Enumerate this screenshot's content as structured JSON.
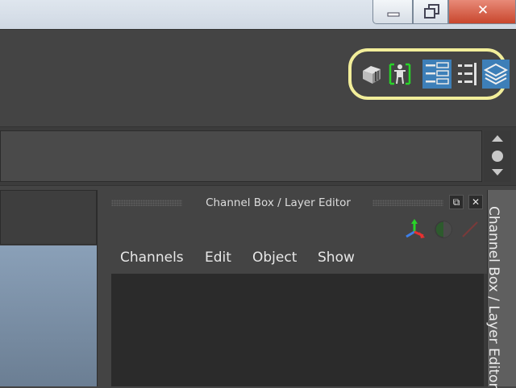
{
  "window": {
    "minimize_icon": "minimize-icon",
    "maximize_icon": "restore-icon",
    "close_icon": "close-icon",
    "close_glyph": "✕"
  },
  "toolbar": {
    "icons": [
      "modeling-toolkit-icon",
      "attribute-editor-icon",
      "tool-settings-icon",
      "channel-box-toggle-icon",
      "layer-editor-icon"
    ],
    "highlight_color": "#f2ee9a"
  },
  "channel_box": {
    "title": "Channel Box / Layer Editor",
    "float_glyph": "⧉",
    "close_glyph": "✕",
    "menu": [
      "Channels",
      "Edit",
      "Object",
      "Show"
    ],
    "tab_label": "Channel Box / Layer Editor"
  },
  "colors": {
    "panel": "#444444",
    "body": "#2b2b2b",
    "accent_blue": "#3d7fb8",
    "active_green": "#28d428"
  }
}
